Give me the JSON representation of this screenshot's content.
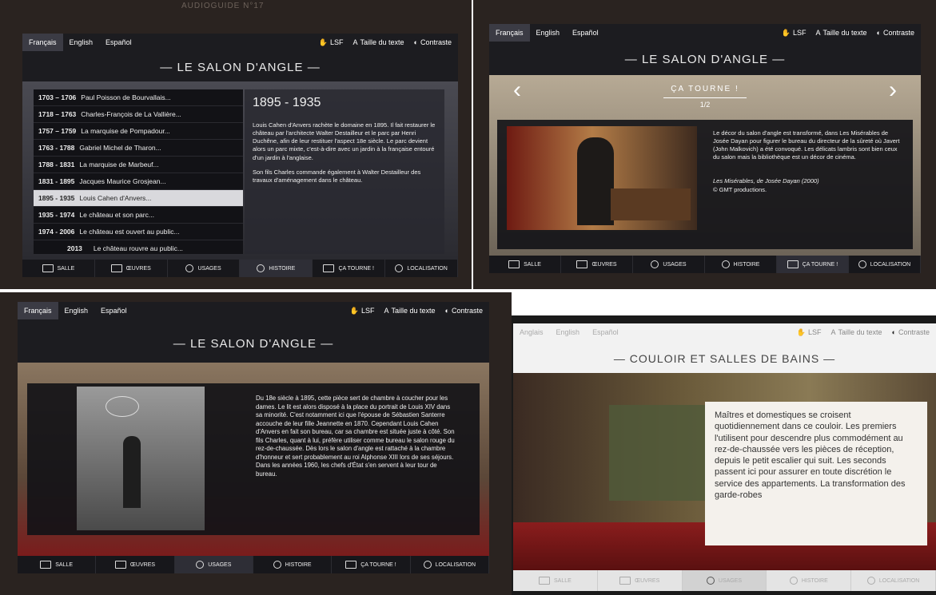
{
  "watermark": "AUDIOGUIDE N°17",
  "langs": [
    "Français",
    "English",
    "Español"
  ],
  "tools": {
    "lsf": "LSF",
    "text_size": "Taille du texte",
    "contrast": "Contraste"
  },
  "nav": [
    "SALLE",
    "ŒUVRES",
    "USAGES",
    "HISTOIRE",
    "ÇA TOURNE !",
    "LOCALISATION"
  ],
  "colors": {
    "screen_bg": "#1c1c20",
    "panel": "#2b2b33",
    "selected_row": "#d9d9dd",
    "carpet_red": "#8a1d1d"
  },
  "screen1": {
    "title": "— LE SALON D'ANGLE —",
    "timeline": [
      {
        "years": "1703 – 1706",
        "label": "Paul Poisson de Bourvallais..."
      },
      {
        "years": "1718 – 1763",
        "label": "Charles-François de La Vallière..."
      },
      {
        "years": "1757 – 1759",
        "label": "La marquise de Pompadour..."
      },
      {
        "years": "1763 - 1788",
        "label": "Gabriel Michel de Tharon..."
      },
      {
        "years": "1788 - 1831",
        "label": "La marquise de Marbeuf..."
      },
      {
        "years": "1831 - 1895",
        "label": "Jacques Maurice Grosjean..."
      },
      {
        "years": "1895 - 1935",
        "label": "Louis Cahen d'Anvers..."
      },
      {
        "years": "1935 - 1974",
        "label": "Le château et son parc..."
      },
      {
        "years": "1974 - 2006",
        "label": "Le château est ouvert au public..."
      },
      {
        "years": "2013",
        "label": "Le château rouvre au public..."
      }
    ],
    "detail_heading": "1895 - 1935",
    "detail_p1": "Louis Cahen d'Anvers rachète le domaine en 1895. Il fait restaurer le château par l'architecte Walter Destailleur et le parc par Henri Duchêne, afin de leur restituer l'aspect 18e siècle. Le parc devient alors un parc mixte, c'est-à-dire avec un jardin à la française entouré d'un jardin à l'anglaise.",
    "detail_p2": "Son fils Charles commande également à Walter Destailleur des travaux d'aménagement dans le château."
  },
  "screen2": {
    "title": "— LE SALON D'ANGLE —",
    "section": "ÇA TOURNE !",
    "pager": "1/2",
    "prev": "‹",
    "next": "›",
    "text": "Le décor du salon d'angle est transformé, dans Les Misérables de Josée Dayan pour figurer le bureau du directeur de la sûreté où Javert (John Malkovich) a été convoqué. Les délicats lambris sont bien ceux du salon mais la bibliothèque est un décor de cinéma.",
    "credit1": "Les Misérables, de Josée Dayan (2000)",
    "credit2": "© GMT productions."
  },
  "screen3": {
    "title": "— LE SALON D'ANGLE —",
    "text": "Du 18e siècle à 1895, cette pièce sert de chambre à coucher pour les dames. Le lit est alors disposé à la place du portrait de Louis XIV dans sa minorité. C'est notamment ici que l'épouse de Sébastien Santerre accouche de leur fille Jeannette en 1870. Cependant Louis Cahen d'Anvers en fait son bureau, car sa chambre est située juste à côté. Son fils Charles, quant à lui, préfère utiliser comme bureau le salon rouge du rez-de-chaussée. Dès lors le salon d'angle est rattaché à la chambre d'honneur et sert probablement au roi Alphonse XIII lors de ses séjours. Dans les années 1960, les chefs d'État s'en servent à leur tour de bureau."
  },
  "screen4": {
    "title": "— COULOIR ET SALLES DE BAINS —",
    "langs": [
      "Anglais",
      "English",
      "Español"
    ],
    "text": "Maîtres et domestiques se croisent quotidiennement dans ce couloir. Les premiers l'utilisent pour descendre plus commodément au rez-de-chaussée vers les pièces de réception, depuis le petit escalier qui suit. Les seconds passent ici pour assurer en toute discrétion le service des appartements. La transformation des garde-robes"
  }
}
